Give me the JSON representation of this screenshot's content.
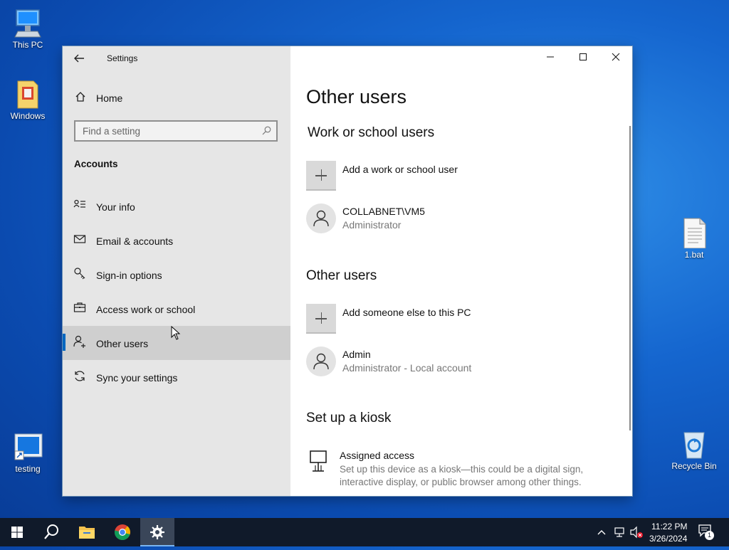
{
  "desktop": {
    "icons": [
      {
        "label": "This PC"
      },
      {
        "label": "Windows"
      },
      {
        "label": "testing"
      },
      {
        "label": "1.bat"
      },
      {
        "label": "Recycle Bin"
      }
    ]
  },
  "window": {
    "title": "Settings",
    "sidebar": {
      "home_label": "Home",
      "search_placeholder": "Find a setting",
      "section_label": "Accounts",
      "items": [
        {
          "label": "Your info",
          "icon": "person-card-icon"
        },
        {
          "label": "Email & accounts",
          "icon": "mail-icon"
        },
        {
          "label": "Sign-in options",
          "icon": "key-icon"
        },
        {
          "label": "Access work or school",
          "icon": "briefcase-icon"
        },
        {
          "label": "Other users",
          "icon": "person-add-icon",
          "selected": true
        },
        {
          "label": "Sync your settings",
          "icon": "sync-icon"
        }
      ]
    },
    "main": {
      "page_title": "Other users",
      "work_school": {
        "heading": "Work or school users",
        "add_label": "Add a work or school user",
        "users": [
          {
            "name": "COLLABNET\\VM5",
            "role": "Administrator"
          }
        ]
      },
      "other_users": {
        "heading": "Other users",
        "add_label": "Add someone else to this PC",
        "users": [
          {
            "name": "Admin",
            "role": "Administrator - Local account"
          }
        ]
      },
      "kiosk": {
        "heading": "Set up a kiosk",
        "title": "Assigned access",
        "description": "Set up this device as a kiosk—this could be a digital sign, interactive display, or public browser among other things."
      }
    }
  },
  "taskbar": {
    "time": "11:22 PM",
    "date": "3/26/2024",
    "notification_count": "1",
    "accent": "#0067c0"
  }
}
